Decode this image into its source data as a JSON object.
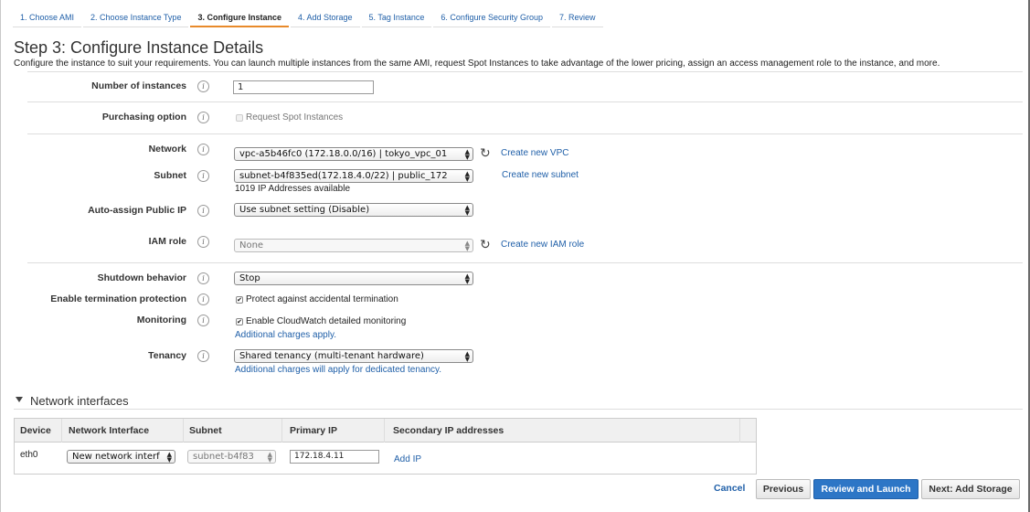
{
  "wizard_tabs": [
    {
      "label": "1. Choose AMI"
    },
    {
      "label": "2. Choose Instance Type"
    },
    {
      "label": "3. Configure Instance"
    },
    {
      "label": "4. Add Storage"
    },
    {
      "label": "5. Tag Instance"
    },
    {
      "label": "6. Configure Security Group"
    },
    {
      "label": "7. Review"
    }
  ],
  "page": {
    "title": "Step 3: Configure Instance Details",
    "description": "Configure the instance to suit your requirements. You can launch multiple instances from the same AMI, request Spot Instances to take advantage of the lower pricing, assign an access management role to the instance, and more."
  },
  "info_glyph": "i",
  "form": {
    "num_instances": {
      "label": "Number of instances",
      "value": "1"
    },
    "purchasing": {
      "label": "Purchasing option",
      "checkbox_label": "Request Spot Instances",
      "checked": false
    },
    "network": {
      "label": "Network",
      "value": "vpc-a5b46fc0 (172.18.0.0/16) | tokyo_vpc_01",
      "link": "Create new VPC"
    },
    "subnet": {
      "label": "Subnet",
      "value": "subnet-b4f835ed(172.18.4.0/22) | public_172",
      "available": "1019 IP Addresses available",
      "link": "Create new subnet"
    },
    "public_ip": {
      "label": "Auto-assign Public IP",
      "value": "Use subnet setting (Disable)"
    },
    "iam_role": {
      "label": "IAM role",
      "value": "None",
      "link": "Create new IAM role"
    },
    "shutdown": {
      "label": "Shutdown behavior",
      "value": "Stop"
    },
    "termination": {
      "label": "Enable termination protection",
      "checkbox_label": "Protect against accidental termination",
      "checked": true
    },
    "monitoring": {
      "label": "Monitoring",
      "checkbox_label": "Enable CloudWatch detailed monitoring",
      "checked": true,
      "note": "Additional charges apply."
    },
    "tenancy": {
      "label": "Tenancy",
      "value": "Shared tenancy (multi-tenant hardware)",
      "note": "Additional charges will apply for dedicated tenancy."
    }
  },
  "network_interfaces": {
    "heading": "Network interfaces",
    "columns": [
      "Device",
      "Network Interface",
      "Subnet",
      "Primary IP",
      "Secondary IP addresses"
    ],
    "row": {
      "device": "eth0",
      "interface": "New network interf",
      "subnet": "subnet-b4f83",
      "primary_ip": "172.18.4.11",
      "add_ip": "Add IP"
    }
  },
  "footer": {
    "cancel": "Cancel",
    "previous": "Previous",
    "review": "Review and Launch",
    "next": "Next: Add Storage"
  },
  "colors": {
    "link": "#1f5fa8",
    "primary_button": "#2d76c6",
    "active_tab_underline": "#e88a2a"
  }
}
